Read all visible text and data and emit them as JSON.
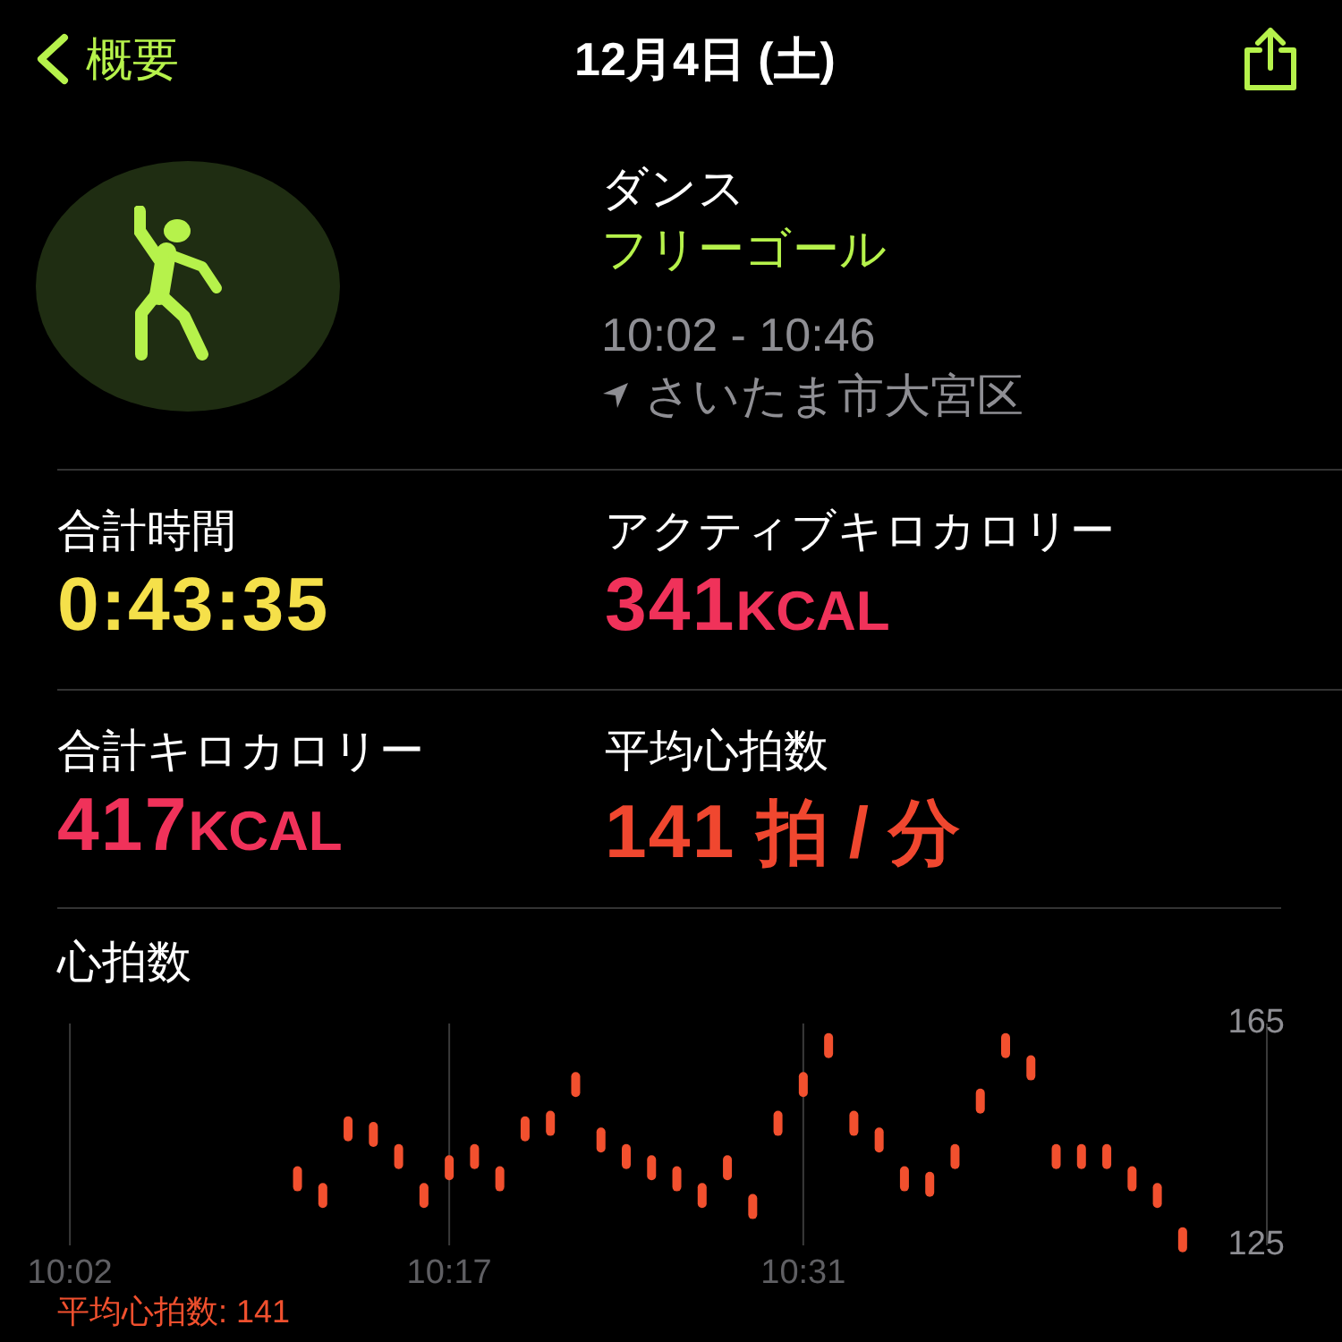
{
  "nav": {
    "back": "概要",
    "title": "12月4日 (土)"
  },
  "workout": {
    "type": "ダンス",
    "goal": "フリーゴール",
    "time": "10:02 - 10:46",
    "location": "さいたま市大宮区"
  },
  "stats": [
    {
      "label": "合計時間",
      "value": "0:43:35",
      "color": "#f5e04a"
    },
    {
      "label": "アクティブキロカロリー",
      "value": "341",
      "unit": "KCAL",
      "color": "#f0325a"
    },
    {
      "label": "合計キロカロリー",
      "value": "417",
      "unit": "KCAL",
      "color": "#f0325a"
    },
    {
      "label": "平均心拍数",
      "value": "141",
      "unit": "拍 / 分",
      "color": "#f0472f"
    }
  ],
  "heart": {
    "average": "平均心拍数: 141",
    "chart_data": {
      "type": "scatter",
      "ylim": [
        125,
        165
      ],
      "grid": true,
      "yticks": [
        125,
        165
      ],
      "categories": [
        "10:02",
        null,
        null,
        null,
        null,
        null,
        null,
        null,
        null,
        null,
        null,
        null,
        null,
        null,
        null,
        "10:17",
        null,
        null,
        null,
        null,
        null,
        null,
        null,
        null,
        null,
        null,
        null,
        null,
        null,
        "10:31",
        null,
        null,
        null,
        null,
        null,
        null,
        null,
        null,
        null,
        null,
        null,
        null,
        null,
        null,
        null
      ],
      "series": [
        {
          "name": "心拍数",
          "color": "#f2502e",
          "values": [
            null,
            null,
            null,
            null,
            null,
            null,
            null,
            null,
            null,
            137,
            134,
            146,
            145,
            141,
            134,
            139,
            141,
            137,
            146,
            147,
            154,
            144,
            141,
            139,
            137,
            134,
            139,
            132,
            147,
            154,
            161,
            147,
            144,
            137,
            136,
            141,
            151,
            161,
            157,
            141,
            141,
            141,
            137,
            134,
            126
          ]
        }
      ]
    }
  }
}
